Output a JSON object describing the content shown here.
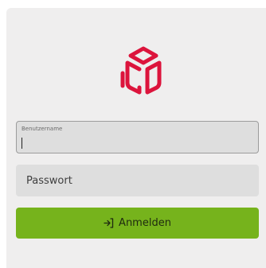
{
  "login_form": {
    "logo_icon": "cube-logo-icon",
    "brand_color": "#dc143c",
    "username": {
      "label": "Benutzername",
      "value": ""
    },
    "password": {
      "placeholder": "Passwort",
      "value": ""
    },
    "submit": {
      "icon": "login-icon",
      "label": "Anmelden",
      "color": "#76b31c"
    }
  }
}
